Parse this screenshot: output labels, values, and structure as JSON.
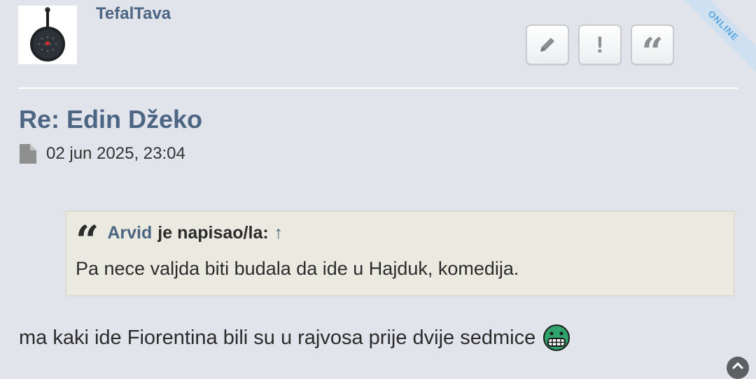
{
  "post": {
    "username": "TefalTava",
    "online_label": "ONLINE",
    "title": "Re: Edin Džeko",
    "date": "02 jun 2025, 23:04",
    "quote": {
      "author": "Arvid",
      "wrote_label": "je napisao/la:",
      "arrow": "↑",
      "text": "Pa nece valjda biti budala da ide u Hajduk, komedija."
    },
    "body": "ma kaki ide Fiorentina bili su u rajvosa prije dvije sedmice"
  },
  "actions": {
    "report_glyph": "!",
    "quote_glyph": "“"
  },
  "icons": {
    "avatar": "frying-pan-icon",
    "edit": "pencil-icon",
    "report": "exclamation-icon",
    "quote": "quote-icon",
    "date": "document-icon",
    "smiley": "grin-smiley-icon",
    "scroll": "chevron-up-icon"
  },
  "colors": {
    "accent": "#4c6583",
    "background": "#e1e4ea",
    "quote_background": "#ebeae0",
    "online": "#5aa6e0"
  }
}
